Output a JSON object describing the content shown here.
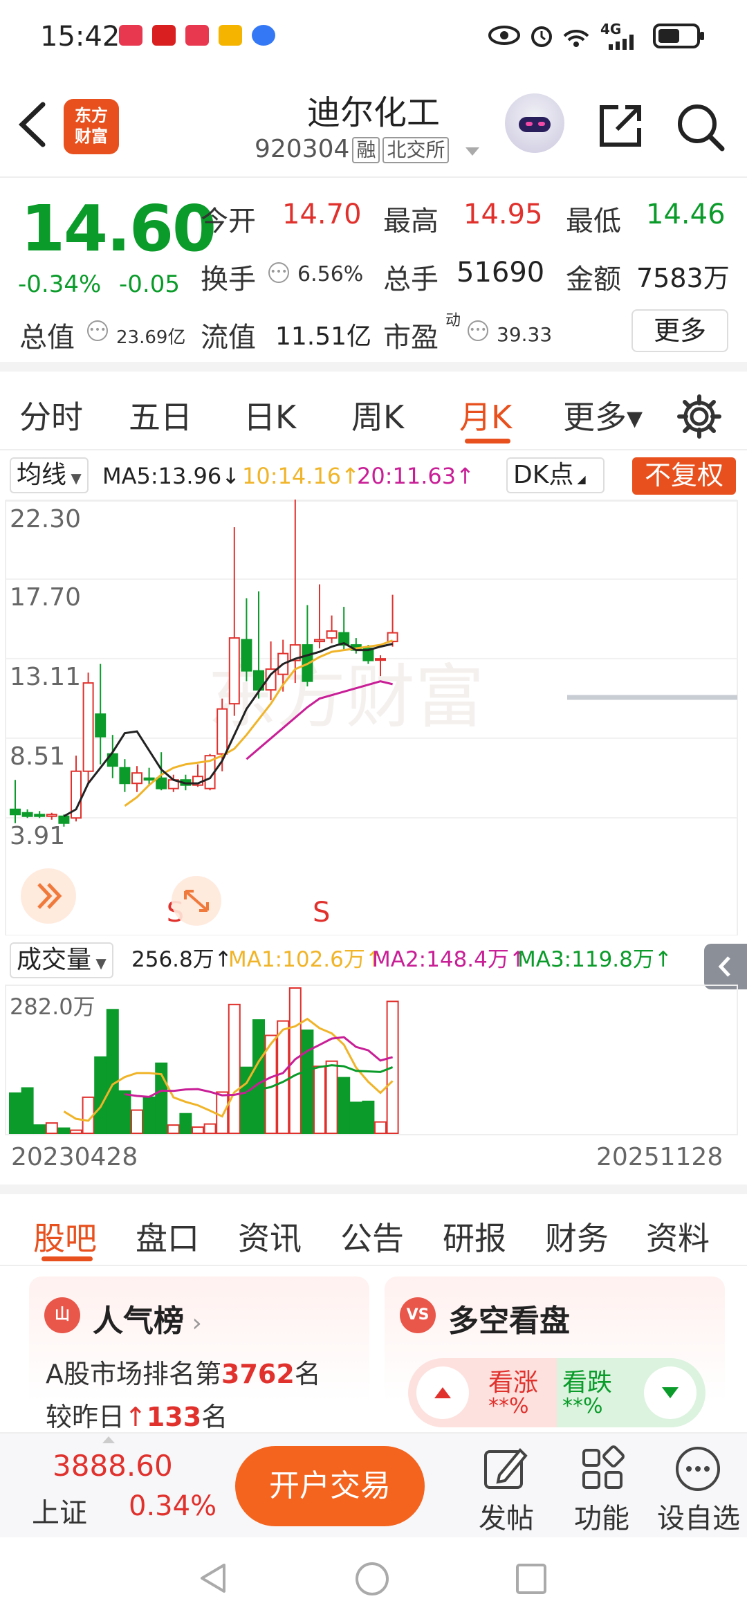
{
  "status_bar": {
    "time": "15:42",
    "network": "4G"
  },
  "header": {
    "title": "迪尔化工",
    "code": "920304",
    "tag_margin": "融",
    "tag_exchange": "北交所",
    "logo_line1": "东方",
    "logo_line2": "财富"
  },
  "quote": {
    "price": "14.60",
    "change_pct": "-0.34%",
    "change": "-0.05",
    "open_label": "今开",
    "open": "14.70",
    "high_label": "最高",
    "high": "14.95",
    "low_label": "最低",
    "low": "14.46",
    "turnover_label": "换手",
    "turnover": "6.56%",
    "volume_label": "总手",
    "volume": "51690",
    "amount_label": "金额",
    "amount": "7583万",
    "mktcap_label": "总值",
    "mktcap": "23.69亿",
    "float_label": "流值",
    "float": "11.51亿",
    "pe_label": "市盈",
    "pe_sup": "动",
    "pe": "39.33",
    "more_label": "更多"
  },
  "period_tabs": [
    "分时",
    "五日",
    "日K",
    "周K",
    "月K",
    "更多▾"
  ],
  "active_period": 4,
  "chart_toolbar": {
    "ma_dropdown": "均线",
    "ma5": "MA5:13.96↓",
    "ma10": "10:14.16↑",
    "ma20": "20:11.63↑",
    "dk_label": "DK点",
    "adjust_btn": "不复权"
  },
  "colors": {
    "up": "#e0312d",
    "down": "#0a9b2a",
    "accent": "#e8501d",
    "ma5": "#222222",
    "ma10": "#f0b429",
    "ma20": "#c81e96"
  },
  "chart_data": {
    "type": "candlestick",
    "period": "monthly",
    "y_ticks": [
      "22.30",
      "17.70",
      "13.11",
      "8.51",
      "3.91"
    ],
    "ylim": [
      3.91,
      22.3
    ],
    "signal_label": "S",
    "signals_at_index": [
      13,
      25
    ],
    "candles": [
      {
        "o": 4.4,
        "c": 4.1,
        "h": 6.1,
        "l": 3.6
      },
      {
        "o": 4.2,
        "c": 4.0,
        "h": 4.4,
        "l": 3.9
      },
      {
        "o": 4.1,
        "c": 4.0,
        "h": 4.3,
        "l": 3.9
      },
      {
        "o": 4.0,
        "c": 4.1,
        "h": 4.2,
        "l": 3.8
      },
      {
        "o": 4.0,
        "c": 3.6,
        "h": 4.1,
        "l": 3.4
      },
      {
        "o": 3.9,
        "c": 6.6,
        "h": 7.5,
        "l": 3.7
      },
      {
        "o": 6.6,
        "c": 11.7,
        "h": 12.3,
        "l": 5.8
      },
      {
        "o": 9.9,
        "c": 8.6,
        "h": 12.8,
        "l": 7.0
      },
      {
        "o": 7.6,
        "c": 6.9,
        "h": 8.7,
        "l": 6.2
      },
      {
        "o": 6.8,
        "c": 5.9,
        "h": 7.3,
        "l": 5.4
      },
      {
        "o": 5.9,
        "c": 6.5,
        "h": 6.9,
        "l": 5.4
      },
      {
        "o": 6.2,
        "c": 6.1,
        "h": 6.8,
        "l": 5.8
      },
      {
        "o": 6.2,
        "c": 5.6,
        "h": 7.7,
        "l": 5.5
      },
      {
        "o": 5.6,
        "c": 6.1,
        "h": 6.4,
        "l": 5.4
      },
      {
        "o": 6.1,
        "c": 5.8,
        "h": 6.4,
        "l": 5.5
      },
      {
        "o": 5.8,
        "c": 6.3,
        "h": 7.0,
        "l": 5.7
      },
      {
        "o": 5.6,
        "c": 7.5,
        "h": 7.6,
        "l": 5.5
      },
      {
        "o": 7.6,
        "c": 10.2,
        "h": 10.8,
        "l": 6.6
      },
      {
        "o": 10.5,
        "c": 14.3,
        "h": 20.7,
        "l": 9.8
      },
      {
        "o": 14.2,
        "c": 12.4,
        "h": 16.6,
        "l": 11.8
      },
      {
        "o": 12.4,
        "c": 11.3,
        "h": 17.0,
        "l": 10.8
      },
      {
        "o": 11.3,
        "c": 12.5,
        "h": 14.1,
        "l": 10.7
      },
      {
        "o": 12.2,
        "c": 13.4,
        "h": 14.2,
        "l": 11.2
      },
      {
        "o": 13.0,
        "c": 13.9,
        "h": 22.3,
        "l": 11.7
      },
      {
        "o": 13.9,
        "c": 11.8,
        "h": 16.2,
        "l": 11.5
      },
      {
        "o": 14.1,
        "c": 14.2,
        "h": 17.4,
        "l": 13.7
      },
      {
        "o": 14.3,
        "c": 14.7,
        "h": 15.6,
        "l": 14.0
      },
      {
        "o": 14.6,
        "c": 13.9,
        "h": 16.1,
        "l": 13.6
      },
      {
        "o": 13.9,
        "c": 13.6,
        "h": 14.3,
        "l": 13.4
      },
      {
        "o": 13.7,
        "c": 13.0,
        "h": 13.9,
        "l": 12.8
      },
      {
        "o": 13.1,
        "c": 13.1,
        "h": 13.3,
        "l": 12.1
      },
      {
        "o": 14.1,
        "c": 14.6,
        "h": 16.8,
        "l": 13.8
      }
    ],
    "ma5": [
      null,
      null,
      null,
      null,
      4.0,
      4.4,
      5.9,
      6.8,
      7.7,
      8.8,
      8.9,
      7.8,
      6.7,
      6.1,
      5.9,
      5.9,
      6.2,
      7.2,
      8.7,
      10.2,
      11.2,
      12.2,
      12.8,
      13.1,
      13.3,
      13.5,
      13.8,
      14.0,
      13.6,
      13.6,
      13.8,
      13.96
    ],
    "ma10": [
      null,
      null,
      null,
      null,
      null,
      null,
      null,
      null,
      null,
      4.6,
      5.1,
      5.8,
      6.4,
      6.8,
      7.0,
      7.1,
      7.2,
      7.5,
      7.9,
      8.7,
      9.6,
      10.5,
      11.6,
      12.5,
      12.8,
      13.2,
      13.5,
      13.6,
      13.7,
      13.8,
      13.9,
      14.16
    ],
    "ma20": [
      null,
      null,
      null,
      null,
      null,
      null,
      null,
      null,
      null,
      null,
      null,
      null,
      null,
      null,
      null,
      null,
      null,
      null,
      null,
      7.3,
      7.9,
      8.5,
      9.1,
      9.7,
      10.3,
      10.8,
      11.0,
      11.2,
      11.4,
      11.6,
      11.8,
      11.63
    ]
  },
  "volume_toolbar": {
    "dropdown": "成交量",
    "value": "256.8万↑",
    "ma1": "MA1:102.6万↑",
    "ma2": "MA2:148.4万↑",
    "ma3": "MA3:119.8万↑"
  },
  "volume_data": {
    "y_top_label": "282.0万",
    "max": 282.0,
    "values": [
      78,
      88,
      16,
      20,
      10,
      6,
      70,
      148,
      240,
      82,
      45,
      70,
      136,
      16,
      38,
      12,
      18,
      80,
      250,
      128,
      220,
      190,
      218,
      282,
      200,
      130,
      140,
      108,
      60,
      62,
      22,
      256
    ]
  },
  "date_start": "20230428",
  "date_end": "20251128",
  "sub_tabs": [
    "股吧",
    "盘口",
    "资讯",
    "公告",
    "研报",
    "财务",
    "资料"
  ],
  "active_sub_tab": 0,
  "popularity_card": {
    "icon": "山",
    "title": "人气榜",
    "line1_prefix": "A股市场排名第",
    "rank": "3762",
    "line1_suffix": "名",
    "line2_prefix": "较昨日",
    "rank_change": "133",
    "line2_suffix": "名"
  },
  "sentiment_card": {
    "icon": "VS",
    "title": "多空看盘",
    "bull_label": "看涨",
    "bull_value": "**%",
    "bear_label": "看跌",
    "bear_value": "**%"
  },
  "bottom_bar": {
    "index_value": "3888.60",
    "index_name": "上证",
    "index_change": "0.34%",
    "trade_button": "开户交易",
    "post_label": "发帖",
    "functions_label": "功能",
    "watchlist_label": "设自选"
  }
}
